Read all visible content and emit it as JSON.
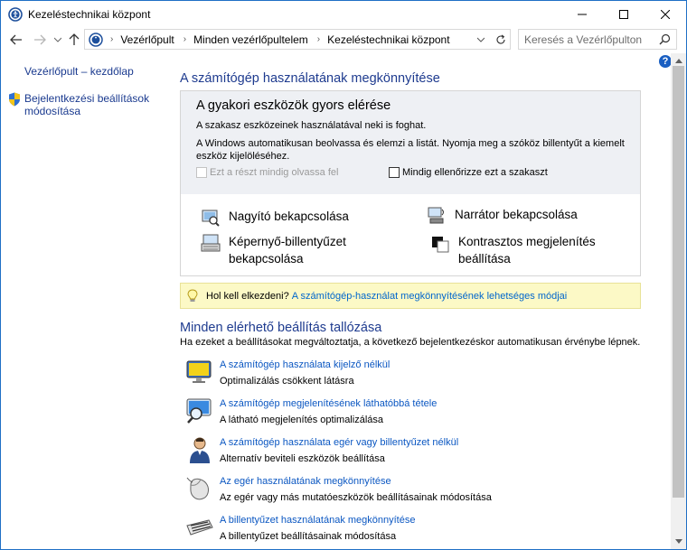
{
  "window": {
    "title": "Kezeléstechnikai központ"
  },
  "address": {
    "crumbs": [
      "Vezérlőpult",
      "Minden vezérlőpultelem",
      "Kezeléstechnikai központ"
    ],
    "search_placeholder": "Keresés a Vezérlőpulton"
  },
  "sidebar": {
    "home": "Vezérlőpult – kezdőlap",
    "login_line1": "Bejelentkezési beállítások",
    "login_line2": "módosítása"
  },
  "main": {
    "heading": "A számítógép használatának megkönnyítése",
    "quick": {
      "title": "A gyakori eszközök gyors elérése",
      "line1": "A szakasz eszközeinek használatával neki is foghat.",
      "line2": "A Windows automatikusan beolvassa és elemzi a listát. Nyomja meg a szóköz billentyűt a kiemelt eszköz kijelöléséhez.",
      "chk_read": "Ezt a részt mindig olvassa fel",
      "chk_scan": "Mindig ellenőrizze ezt a szakaszt",
      "tools": {
        "magnifier": "Nagyító bekapcsolása",
        "narrator": "Narrátor bekapcsolása",
        "osk_line1": "Képernyő-billentyűzet",
        "osk_line2": "bekapcsolása",
        "contrast_line1": "Kontrasztos megjelenítés",
        "contrast_line2": "beállítása"
      }
    },
    "tip": {
      "label": "Hol kell elkezdeni?",
      "link": "A számítógép-használat megkönnyítésének lehetséges módjai"
    },
    "browse": {
      "heading": "Minden elérhető beállítás tallózása",
      "desc": "Ha ezeket a beállításokat megváltoztatja, a következő bejelentkezéskor automatikusan érvénybe lépnek.",
      "items": [
        {
          "title": "A számítógép használata kijelző nélkül",
          "desc": "Optimalizálás csökkent látásra"
        },
        {
          "title": "A számítógép megjelenítésének láthatóbbá tétele",
          "desc": "A látható megjelenítés optimalizálása"
        },
        {
          "title": "A számítógép használata egér vagy billentyűzet nélkül",
          "desc": "Alternatív beviteli eszközök beállítása"
        },
        {
          "title": "Az egér használatának megkönnyítése",
          "desc": "Az egér vagy más mutatóeszközök beállításainak módosítása"
        },
        {
          "title": "A billentyűzet használatának megkönnyítése",
          "desc": "A billentyűzet beállításainak módosítása"
        }
      ]
    }
  },
  "help_label": "?",
  "colors": {
    "heading": "#1e3b8f",
    "link": "#0b57c2",
    "accent": "#1a5fc2",
    "tip_bg": "#fcf9c6"
  }
}
